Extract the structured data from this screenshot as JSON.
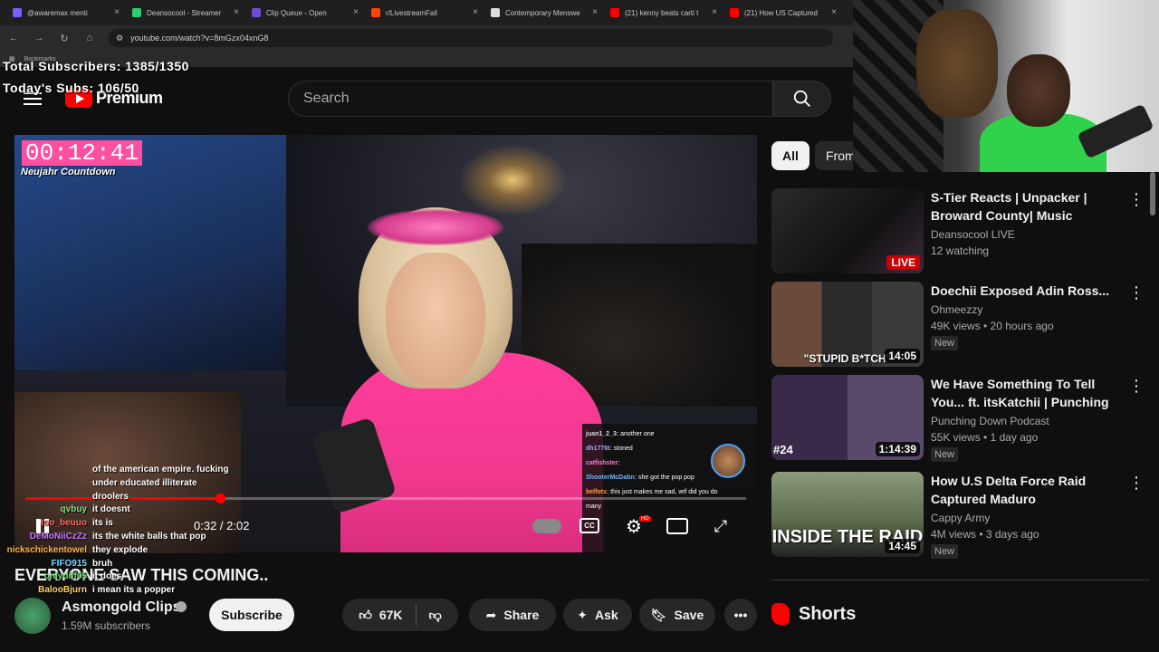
{
  "browser": {
    "tabs": [
      {
        "label": "@awaremax menti",
        "color": "#7b5cff"
      },
      {
        "label": "Deansocool - Streamer",
        "color": "#2ecc71"
      },
      {
        "label": "Clip Queue - Open",
        "color": "#6d4cd8"
      },
      {
        "label": "r/LivestreamFail",
        "color": "#ff4500"
      },
      {
        "label": "Contemporary Menswe",
        "color": "#dddddd"
      },
      {
        "label": "(21) kenny beats carti t",
        "color": "#ff0000"
      },
      {
        "label": "(21) How US Captured",
        "color": "#ff0000"
      }
    ],
    "url": "youtube.com/watch?v=8mGzx04xnG8",
    "bookmarks_label": "Bookmarks"
  },
  "stream_overlay": {
    "total_subs": "Total Subscribers: 1385/1350",
    "today_subs": "Today's Subs: 106/50"
  },
  "header": {
    "logo_word": "Premium",
    "search_placeholder": "Search"
  },
  "video": {
    "timer": "00:12:41",
    "timer_caption": "Neujahr Countdown",
    "progress_fraction": 0.27,
    "time_display": "0:32 / 2:02",
    "cc_label": "CC",
    "hd_label": "HD",
    "chat": [
      {
        "user": "juan1_2_3:",
        "msg": "another one",
        "color": "#d8d8d8"
      },
      {
        "user": "dh1776t:",
        "msg": "stoned",
        "color": "#a6a6ff"
      },
      {
        "user": "",
        "msg": "",
        "color": "#ff5a5a"
      },
      {
        "user": "catfishster:",
        "msg": "",
        "color": "#ff7ad0"
      },
      {
        "user": "ShooterMcDabn:",
        "msg": "she got the pop pop",
        "color": "#6fb7ff"
      },
      {
        "user": "belfots:",
        "msg": "this just makes me sad, wtf did you do",
        "color": "#ffa24a"
      },
      {
        "user": "",
        "msg": "many",
        "color": "#bbbbbb"
      }
    ]
  },
  "left_chat": [
    {
      "user": "",
      "msg": "of the american empire. fucking",
      "color": "#ffffff"
    },
    {
      "user": "",
      "msg": "under educated illiterate",
      "color": "#ffffff"
    },
    {
      "user": "",
      "msg": "droolers",
      "color": "#ffffff"
    },
    {
      "user": "qvbuy",
      "msg": "it doesnt",
      "color": "#7ee07e"
    },
    {
      "user": "too_beuuo",
      "msg": "its is",
      "color": "#ff6a6a"
    },
    {
      "user": "DeMoNiiCzZz",
      "msg": "its the white balls that pop",
      "color": "#c97bff"
    },
    {
      "user": "nickschickentowel",
      "msg": "they explode",
      "color": "#ffb347"
    },
    {
      "user": "",
      "msg": "",
      "color": "#ffffff"
    },
    {
      "user": "FIFO915",
      "msg": "bruh",
      "color": "#7bd7ff"
    },
    {
      "user": "",
      "msg": "",
      "color": "#ffffff"
    },
    {
      "user": "onlydiff05",
      "msg": "it does",
      "color": "#7ee07e"
    },
    {
      "user": "BalooBjurn",
      "msg": "i mean its a popper",
      "color": "#ffd26a"
    }
  ],
  "meta": {
    "title": "EVERYONE SAW THIS COMING..",
    "channel": "Asmongold Clips",
    "subs": "1.59M subscribers",
    "subscribe": "Subscribe",
    "likes": "67K",
    "share": "Share",
    "ask": "Ask",
    "save": "Save"
  },
  "chips": {
    "all": "All",
    "from": "From"
  },
  "recommendations": [
    {
      "title": "S-Tier Reacts | Unpacker | Broward County| Music Reacts...",
      "channel": "Deansocool LIVE",
      "stats": "12 watching",
      "badge": "",
      "duration": "",
      "live": "LIVE",
      "caption": ""
    },
    {
      "title": "Doechii Exposed Adin Ross...",
      "channel": "Ohmeezzy",
      "stats": "49K views • 20 hours ago",
      "badge": "New",
      "duration": "14:05",
      "live": "",
      "caption": "\"STUPID B*TCH\""
    },
    {
      "title": "We Have Something To Tell You... ft. itsKatchii | Punching ...",
      "channel": "Punching Down Podcast",
      "stats": "55K views • 1 day ago",
      "badge": "New",
      "duration": "1:14:39",
      "live": "",
      "caption": "#24"
    },
    {
      "title": "How U.S Delta Force Raid Captured Maduro",
      "channel": "Cappy Army",
      "stats": "4M views • 3 days ago",
      "badge": "New",
      "duration": "14:45",
      "live": "",
      "caption": "INSIDE THE RAID"
    }
  ],
  "shorts_label": "Shorts",
  "colors": {
    "accent": "#ff0000",
    "timer_bg": "#ff4fa0",
    "jacket": "#ff3d9a"
  }
}
